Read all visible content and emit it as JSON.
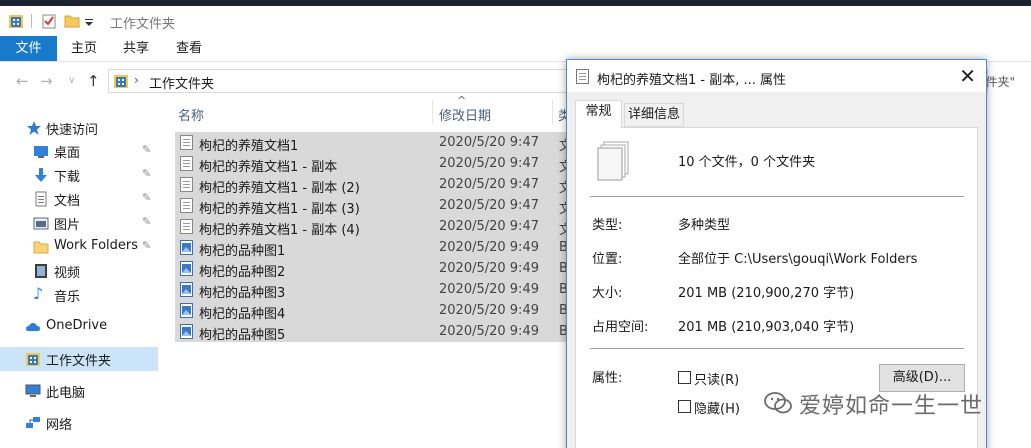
{
  "window": {
    "title": "工作文件夹"
  },
  "ribbon": {
    "tabs": [
      "文件",
      "主页",
      "共享",
      "查看"
    ]
  },
  "address": {
    "current": "工作文件夹",
    "search_tail": "件夹\""
  },
  "nav": {
    "items": [
      {
        "label": "快速访问",
        "icon": "star-icon"
      },
      {
        "label": "桌面",
        "icon": "desktop-icon"
      },
      {
        "label": "下载",
        "icon": "download-icon"
      },
      {
        "label": "文档",
        "icon": "document-icon"
      },
      {
        "label": "图片",
        "icon": "picture-icon"
      },
      {
        "label": "Work Folders",
        "icon": "folder-icon"
      },
      {
        "label": "视频",
        "icon": "video-icon"
      },
      {
        "label": "音乐",
        "icon": "music-icon"
      },
      {
        "label": "OneDrive",
        "icon": "cloud-icon"
      },
      {
        "label": "工作文件夹",
        "icon": "work-folders-icon"
      },
      {
        "label": "此电脑",
        "icon": "pc-icon"
      },
      {
        "label": "网络",
        "icon": "network-icon"
      }
    ]
  },
  "columns": {
    "name": "名称",
    "modified": "修改日期",
    "type": "类"
  },
  "files": [
    {
      "name": "枸杞的养殖文档1",
      "date": "2020/5/20 9:47",
      "type": "文"
    },
    {
      "name": "枸杞的养殖文档1 - 副本",
      "date": "2020/5/20 9:47",
      "type": "文"
    },
    {
      "name": "枸杞的养殖文档1 - 副本 (2)",
      "date": "2020/5/20 9:47",
      "type": "文"
    },
    {
      "name": "枸杞的养殖文档1 - 副本 (3)",
      "date": "2020/5/20 9:47",
      "type": "文"
    },
    {
      "name": "枸杞的养殖文档1 - 副本 (4)",
      "date": "2020/5/20 9:47",
      "type": "文"
    },
    {
      "name": "枸杞的品种图1",
      "date": "2020/5/20 9:49",
      "type": "B"
    },
    {
      "name": "枸杞的品种图2",
      "date": "2020/5/20 9:49",
      "type": "B"
    },
    {
      "name": "枸杞的品种图3",
      "date": "2020/5/20 9:49",
      "type": "B"
    },
    {
      "name": "枸杞的品种图4",
      "date": "2020/5/20 9:49",
      "type": "B"
    },
    {
      "name": "枸杞的品种图5",
      "date": "2020/5/20 9:49",
      "type": "B"
    }
  ],
  "dialog": {
    "title": "枸杞的养殖文档1 - 副本, ... 属性",
    "tabs": [
      "常规",
      "详细信息"
    ],
    "summary": "10 个文件，0 个文件夹",
    "type_label": "类型:",
    "type_value": "多种类型",
    "location_label": "位置:",
    "location_value": "全部位于 C:\\Users\\gouqi\\Work Folders",
    "size_label": "大小:",
    "size_value": "201 MB (210,900,270 字节)",
    "disk_label": "占用空间:",
    "disk_value": "201 MB (210,903,040 字节)",
    "attr_label": "属性:",
    "readonly_label": "只读(R)",
    "hidden_label": "隐藏(H)",
    "advanced_label": "高级(D)..."
  },
  "watermark": {
    "text": "爱婷如命一生一世"
  },
  "colors": {
    "accent": "#1979ca",
    "selection": "#d9d9d9",
    "nav_selected": "#cce4f7"
  }
}
